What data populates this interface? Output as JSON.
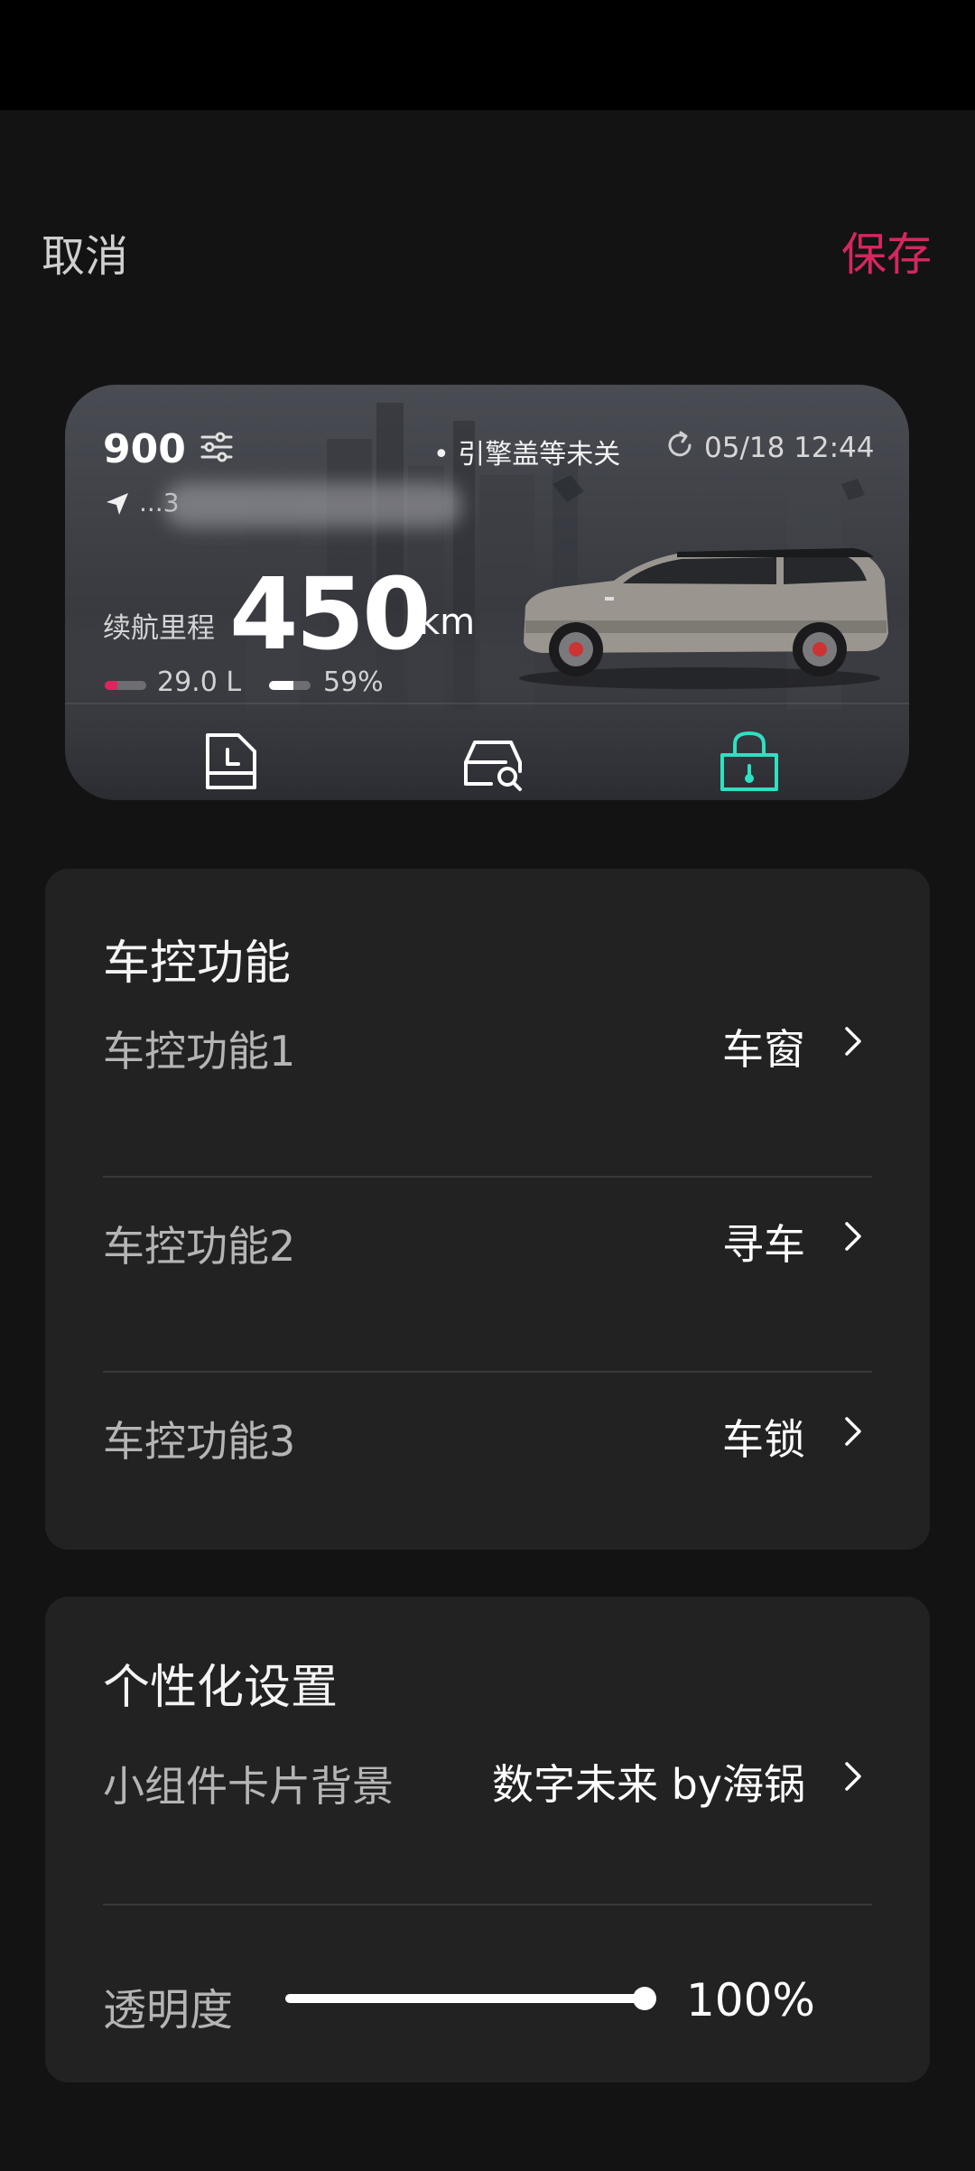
{
  "header": {
    "cancel_label": "取消",
    "save_label": "保存",
    "save_color": "#d5275f"
  },
  "widget": {
    "mileage": "900",
    "alert": "• 引擎盖等未关",
    "timestamp": "05/18 12:44",
    "location": "...3",
    "range_label": "续航里程",
    "range_value": "450",
    "range_unit": "km",
    "fuel_text": "29.0 L",
    "fuel_level": 0.3,
    "fuel_color": "#e0245e",
    "battery_text": "59%",
    "battery_level": 0.59,
    "buttons": [
      {
        "icon": "calendar-icon"
      },
      {
        "icon": "find-car-icon"
      },
      {
        "icon": "lock-icon",
        "color": "#2fe0c2"
      }
    ]
  },
  "vehicle_controls": {
    "title": "车控功能",
    "rows": [
      {
        "label": "车控功能1",
        "value": "车窗"
      },
      {
        "label": "车控功能2",
        "value": "寻车"
      },
      {
        "label": "车控功能3",
        "value": "车锁"
      }
    ]
  },
  "personalization": {
    "title": "个性化设置",
    "background_label": "小组件卡片背景",
    "background_value": "数字未来 by海锅",
    "opacity_label": "透明度",
    "opacity_value": "100%",
    "opacity_level": 1.0
  }
}
